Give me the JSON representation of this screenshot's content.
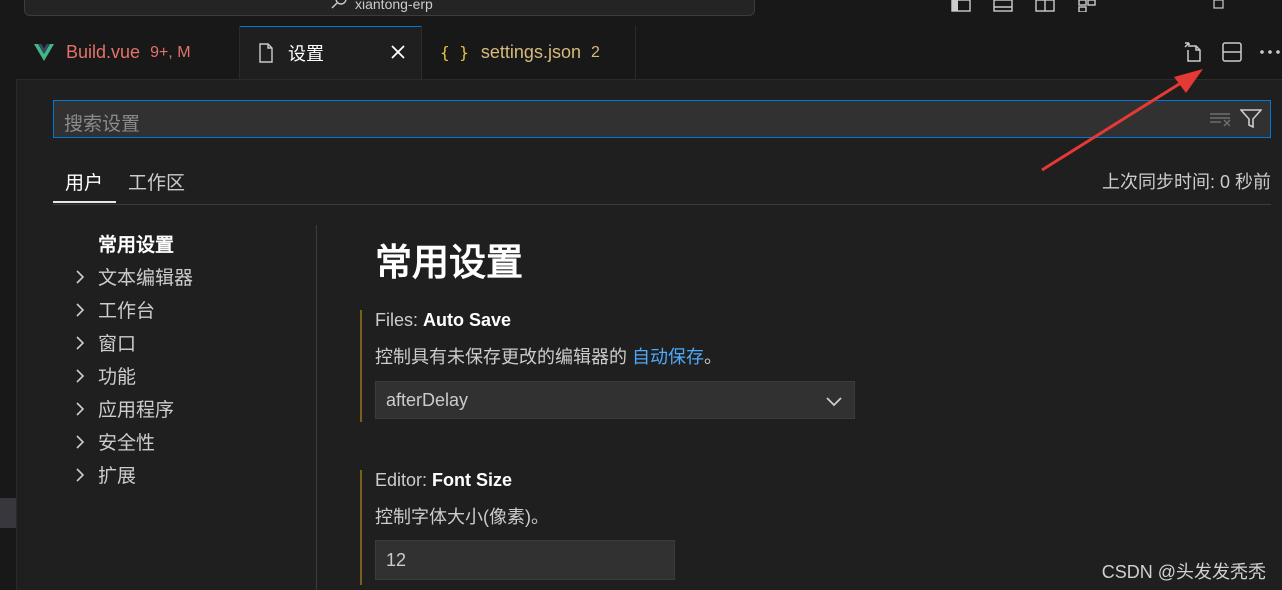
{
  "window": {
    "command_center": "xiantong-erp"
  },
  "tabs": [
    {
      "label": "Build.vue",
      "badge": "9+, M"
    },
    {
      "label": "设置"
    },
    {
      "label": "settings.json",
      "badge": "2"
    }
  ],
  "search": {
    "placeholder": "搜索设置"
  },
  "scope": {
    "user": "用户",
    "workspace": "工作区",
    "sync_status": "上次同步时间: 0 秒前"
  },
  "toc": {
    "heading": "常用设置",
    "items": [
      "文本编辑器",
      "工作台",
      "窗口",
      "功能",
      "应用程序",
      "安全性",
      "扩展"
    ]
  },
  "main": {
    "section_title": "常用设置",
    "settings": [
      {
        "category": "Files: ",
        "name": "Auto Save",
        "desc_prefix": "控制具有未保存更改的编辑器的 ",
        "desc_link": "自动保存",
        "desc_suffix": "。",
        "value": "afterDelay"
      },
      {
        "category": "Editor: ",
        "name": "Font Size",
        "desc": "控制字体大小(像素)。",
        "value": "12"
      }
    ]
  },
  "watermark": "CSDN @头发发秃秃",
  "colors": {
    "accent": "#0078d4",
    "link": "#4daafc",
    "modified": "#e2726b",
    "annotation_arrow": "#e53935"
  },
  "icons": {
    "vue": "vue-logo-icon",
    "file": "file-icon",
    "json": "json-braces-icon",
    "close": "close-icon",
    "open_json": "open-settings-json-icon",
    "split": "split-editor-icon",
    "more": "more-actions-icon"
  }
}
